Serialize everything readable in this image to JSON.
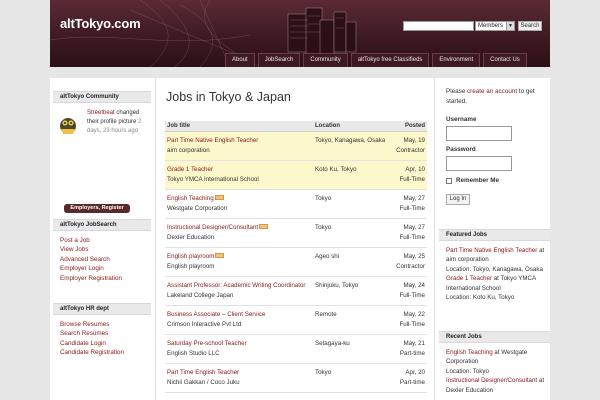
{
  "header": {
    "site_title": "altTokyo.com",
    "search_placeholder": "",
    "members_select": "Members",
    "search_button": "Search"
  },
  "nav": [
    "About",
    "JobSearch",
    "Community",
    "altTokyo free Classifieds",
    "Environment",
    "Contact Us"
  ],
  "sidebar_left": {
    "community": {
      "title": "altTokyo Community",
      "activity_user": "Streetbeat",
      "activity_text": " changed their profile picture ",
      "activity_time": "2 days, 23 hours ago",
      "register_button": "Employers, Register here"
    },
    "jobsearch": {
      "title": "altTokyo JobSearch",
      "links": [
        "Post a Job",
        "View Jobs",
        "Advanced Search",
        "Employer Login",
        "Employer Registration"
      ]
    },
    "hr": {
      "title": "altTokyo HR dept",
      "links": [
        "Browse Resumes",
        "Search Resumes",
        "Candidate Login",
        "Candidate Registration"
      ]
    }
  },
  "main": {
    "page_title": "Jobs in Tokyo & Japan",
    "table": {
      "col_title": "Job title",
      "col_location": "Location",
      "col_posted": "Posted",
      "rows": [
        {
          "title": "Part Time Native English Teacher",
          "company": "aim corporation",
          "location": "Tokyo, Kanagawa, Osaka",
          "date": "May, 19",
          "type": "Contractor",
          "featured": true,
          "new": false
        },
        {
          "title": "Grade 1 Teacher",
          "company": "Tokyo YMCA International School",
          "location": "Koto Ku, Tokyo",
          "date": "Apr, 10",
          "type": "Full-Time",
          "featured": true,
          "new": false
        },
        {
          "title": "English Teaching",
          "company": "Westgate Corporation",
          "location": "Tokyo",
          "date": "May, 27",
          "type": "Full-Time",
          "featured": false,
          "new": true
        },
        {
          "title": "Instructional Designer/Consultant",
          "company": "Dexler Education",
          "location": "Tokyo",
          "date": "May, 27",
          "type": "Full-Time",
          "featured": false,
          "new": true
        },
        {
          "title": "English playroom",
          "company": "English playroom",
          "location": "Ageo shi",
          "date": "May, 25",
          "type": "Contractor",
          "featured": false,
          "new": true
        },
        {
          "title": "Assistant Professor: Academic Writing Coordinator",
          "company": "Lakeland College Japan",
          "location": "Shinjuku, Tokyo",
          "date": "May, 24",
          "type": "Full-Time",
          "featured": false,
          "new": false
        },
        {
          "title": "Business Associate – Client Service",
          "company": "Crimson Interactive Pvt Ltd",
          "location": "Remote",
          "date": "May, 22",
          "type": "Full-Time",
          "featured": false,
          "new": false
        },
        {
          "title": "Saturday Pre-school Teacher",
          "company": "English Studio LLC",
          "location": "Setagaya-ku",
          "date": "May, 21",
          "type": "Part-time",
          "featured": false,
          "new": false
        },
        {
          "title": "Part Time English Teacher",
          "company": "Nichii Gakkan / Coco Juku",
          "location": "Tokyo",
          "date": "Apr, 20",
          "type": "Part-time",
          "featured": false,
          "new": false
        }
      ]
    }
  },
  "sidebar_right": {
    "login": {
      "intro_pre": "Please ",
      "intro_link": "create an account",
      "intro_post": " to get started.",
      "username_label": "Username",
      "password_label": "Password",
      "remember_label": "Remember Me",
      "login_button": "Log In"
    },
    "featured": {
      "title": "Featured Jobs",
      "items": [
        {
          "title": "Part Time Native English Teacher",
          "pre": "",
          "company_line": " at aim corporation",
          "location": "Location: Tokyo, Kanagawa, Osaka"
        },
        {
          "title": "Grade 1 Teacher",
          "company_line": " at Tokyo YMCA International School",
          "location": "Location: Koto Ku, Tokyo"
        }
      ]
    },
    "recent": {
      "title": "Recent Jobs",
      "items": [
        {
          "title": "English Teaching",
          "company_line": " at Westgate Corporation",
          "location": "Location: Tokyo"
        },
        {
          "title": "Instructional Designer/Consultant",
          "company_line": " at Dexler Education",
          "location": ""
        }
      ]
    }
  },
  "colors": {
    "header_bg": "#4a202a",
    "link": "#8a1818",
    "featured_row": "#fdf8cc",
    "widget_title_bg": "#e9e9e9"
  }
}
